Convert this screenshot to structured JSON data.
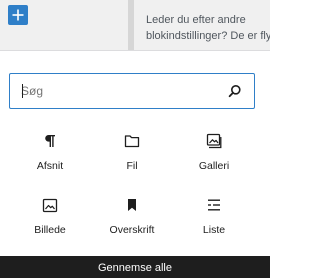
{
  "colors": {
    "accent": "#2f7fc8",
    "toolbar_bg": "#f0f0f0",
    "browse_bar_bg": "#1e1e1e"
  },
  "toolbar": {
    "add_icon": "plus-icon"
  },
  "notice": {
    "line1": "Leder du efter andre",
    "line2": "blokindstillinger? De er flytte"
  },
  "search": {
    "placeholder": "Søg",
    "value": "",
    "icon": "search-icon"
  },
  "blocks": [
    {
      "label": "Afsnit",
      "icon": "paragraph-icon"
    },
    {
      "label": "Fil",
      "icon": "folder-icon"
    },
    {
      "label": "Galleri",
      "icon": "gallery-icon"
    },
    {
      "label": "Billede",
      "icon": "image-icon"
    },
    {
      "label": "Overskrift",
      "icon": "bookmark-icon"
    },
    {
      "label": "Liste",
      "icon": "list-icon"
    }
  ],
  "browse_all": {
    "label": "Gennemse alle"
  }
}
